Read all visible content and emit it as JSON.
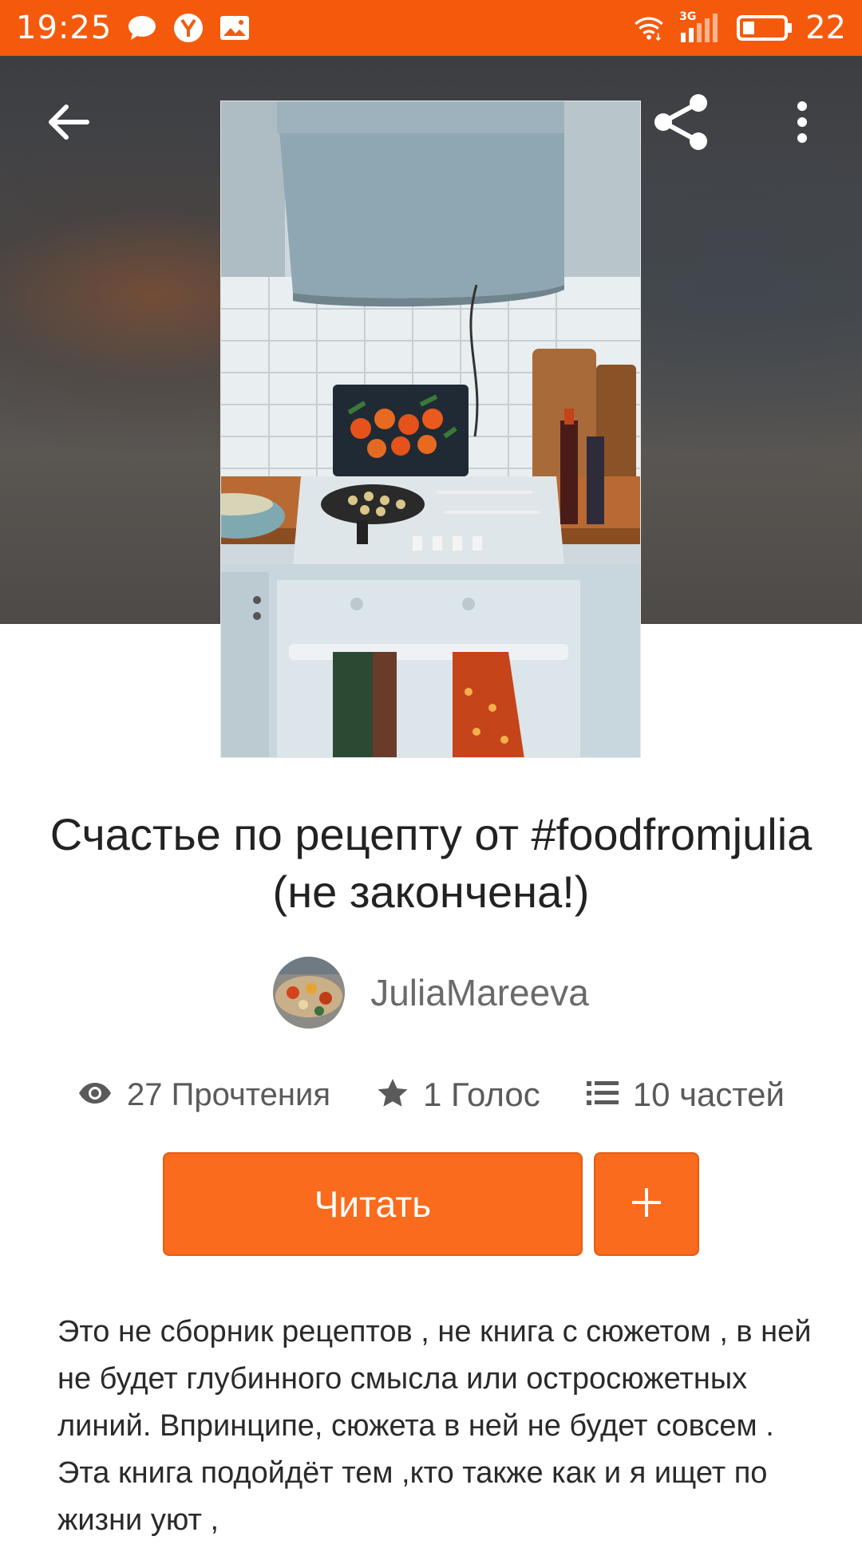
{
  "status_bar": {
    "time": "19:25",
    "network_label": "3G",
    "battery_level": "22",
    "icons": [
      "chat-bubble-icon",
      "yandex-browser-icon",
      "gallery-notification-icon",
      "wifi-icon",
      "signal-icon",
      "battery-icon"
    ]
  },
  "toolbar": {
    "icons": [
      "back-arrow-icon",
      "share-icon",
      "more-vert-icon"
    ]
  },
  "story": {
    "title": "Счастье по рецепту от #foodfromjulia (не закончена!)",
    "author": "JuliaMareeva",
    "stats": {
      "reads": "27 Прочтения",
      "votes": "1 Голос",
      "parts": "10 частей"
    },
    "description": "Это не сборник рецептов , не книга с сюжетом , в ней не будет глубинного смысла или остросюжетных линий. Впринципе, сюжета в ней не будет совсем . Эта книга подойдёт тем ,кто также как и я ищет по жизни уют ,"
  },
  "actions": {
    "read_label": "Читать",
    "add_icon": "plus-icon"
  },
  "colors": {
    "accent": "#f55a0c",
    "button": "#fa6b1d",
    "text": "#222222",
    "muted": "#5a5a5a"
  }
}
